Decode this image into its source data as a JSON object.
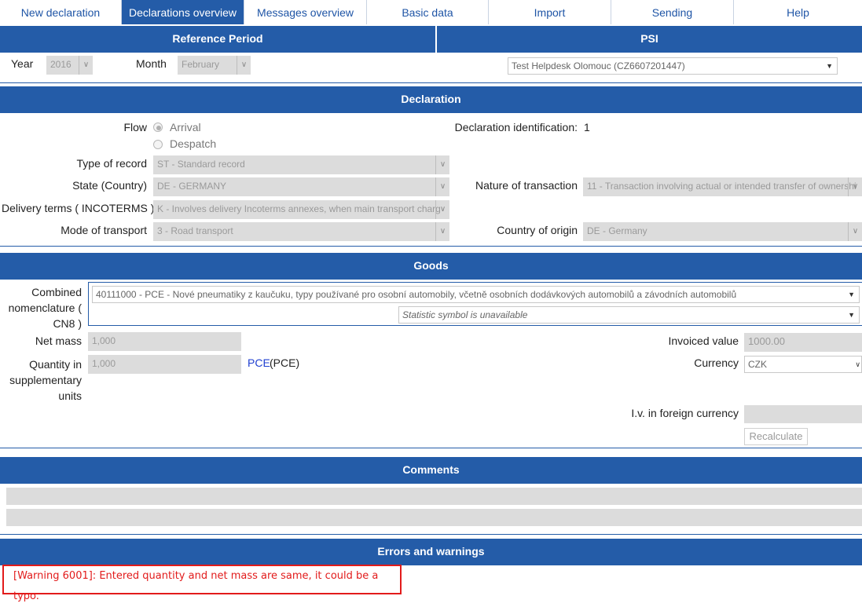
{
  "tabs": [
    {
      "label": "New declaration"
    },
    {
      "label": "Declarations overview"
    },
    {
      "label": "Messages overview"
    },
    {
      "label": "Basic data"
    },
    {
      "label": "Import"
    },
    {
      "label": "Sending"
    },
    {
      "label": "Help"
    }
  ],
  "reference_period": {
    "title": "Reference Period",
    "year_label": "Year",
    "year_value": "2016",
    "month_label": "Month",
    "month_value": "February"
  },
  "psi": {
    "title": "PSI",
    "value": "Test Helpdesk Olomouc (CZ6607201447)"
  },
  "declaration": {
    "title": "Declaration",
    "flow_label": "Flow",
    "flow_options": [
      "Arrival",
      "Despatch"
    ],
    "flow_selected": "Arrival",
    "id_label": "Declaration identification:",
    "id_value": "1",
    "type_label": "Type of record",
    "type_value": "ST - Standard record",
    "state_label": "State (Country)",
    "state_value": "DE - GERMANY",
    "delivery_label": "Delivery terms ( INCOTERMS )",
    "delivery_value": "K - Involves delivery Incoterms annexes, when main transport charg",
    "mode_label": "Mode of transport",
    "mode_value": "3 - Road transport",
    "nature_label": "Nature of transaction",
    "nature_value": "11 - Transaction involving actual or intended transfer of ownershi",
    "origin_label": "Country of origin",
    "origin_value": "DE - Germany"
  },
  "goods": {
    "title": "Goods",
    "cn_label": "Combined nomenclature ( CN8 )",
    "cn_value": "40111000 - PCE - Nové pneumatiky z kaučuku, typy používané pro osobní automobily, včetně osobních dodávkových automobilů a závodních automobilů",
    "stat_symbol": "Statistic symbol is unavailable",
    "net_mass_label": "Net mass",
    "net_mass_value": "1,000",
    "qty_label": "Quantity in supplementary units",
    "qty_value": "1,000",
    "qty_unit_link": "PCE",
    "qty_unit_suffix": "(PCE)",
    "invoiced_label": "Invoiced value",
    "invoiced_value": "1000.00",
    "currency_label": "Currency",
    "currency_value": "CZK",
    "iv_foreign_label": "I.v. in foreign currency",
    "iv_foreign_value": "",
    "recalc_label": "Recalculate"
  },
  "comments": {
    "title": "Comments"
  },
  "errors": {
    "title": "Errors and warnings",
    "message": "[Warning 6001]: Entered quantity and net mass are same, it could be a typo."
  },
  "colors": {
    "primary": "#245ca8",
    "warning": "#e21b1b",
    "disabled_field": "#dcdcdc"
  }
}
